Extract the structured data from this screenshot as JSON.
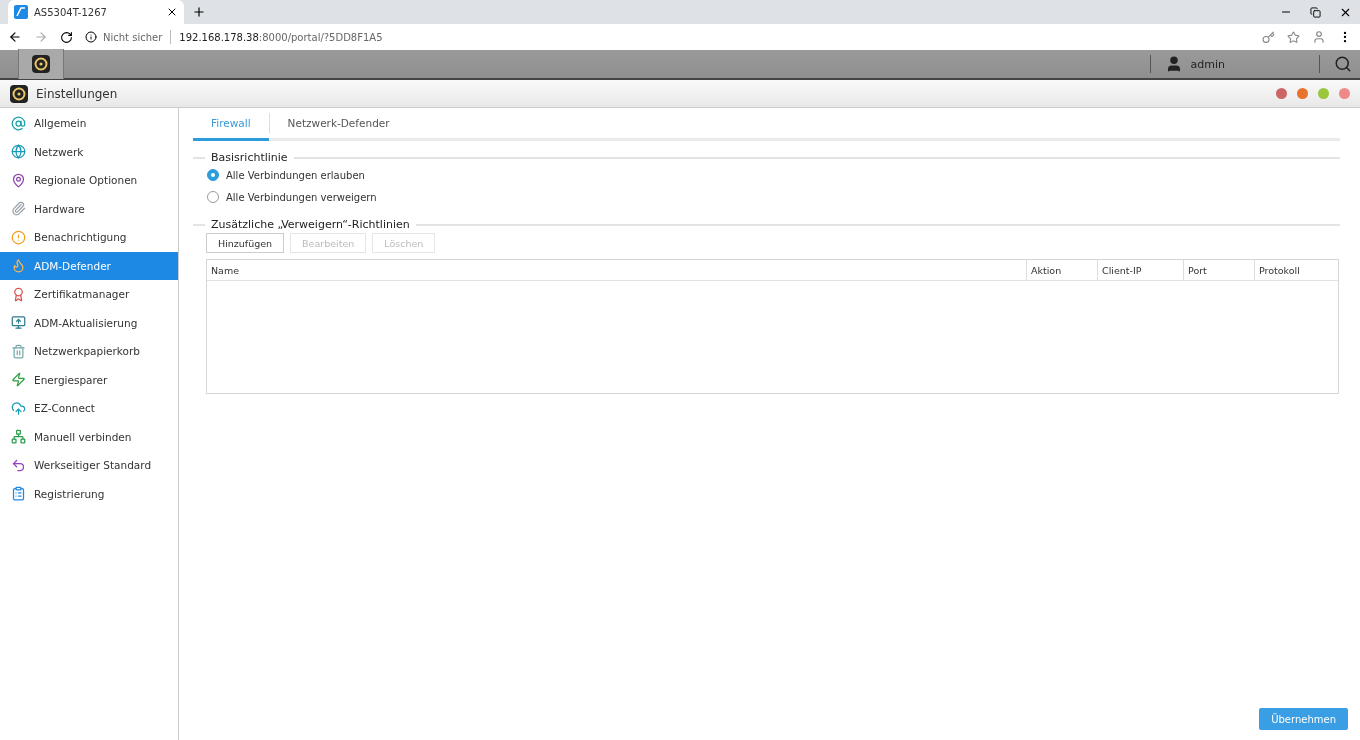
{
  "browser": {
    "tab_title": "AS5304T-1267",
    "security": "Nicht sicher",
    "url_host": "192.168.178.38",
    "url_rest": ":8000/portal/?5DD8F1A5"
  },
  "topbar": {
    "user": "admin"
  },
  "window": {
    "title": "Einstellungen"
  },
  "sidebar": {
    "items": [
      {
        "label": "Allgemein",
        "selected": false
      },
      {
        "label": "Netzwerk",
        "selected": false
      },
      {
        "label": "Regionale Optionen",
        "selected": false
      },
      {
        "label": "Hardware",
        "selected": false
      },
      {
        "label": "Benachrichtigung",
        "selected": false
      },
      {
        "label": "ADM-Defender",
        "selected": true
      },
      {
        "label": "Zertifikatmanager",
        "selected": false
      },
      {
        "label": "ADM-Aktualisierung",
        "selected": false
      },
      {
        "label": "Netzwerkpapierkorb",
        "selected": false
      },
      {
        "label": "Energiesparer",
        "selected": false
      },
      {
        "label": "EZ-Connect",
        "selected": false
      },
      {
        "label": "Manuell verbinden",
        "selected": false
      },
      {
        "label": "Werkseitiger Standard",
        "selected": false
      },
      {
        "label": "Registrierung",
        "selected": false
      }
    ]
  },
  "tabs": [
    {
      "label": "Firewall",
      "selected": true
    },
    {
      "label": "Netzwerk-Defender",
      "selected": false
    }
  ],
  "base_policy": {
    "title": "Basisrichtlinie",
    "options": [
      {
        "label": "Alle Verbindungen erlauben",
        "selected": true
      },
      {
        "label": "Alle Verbindungen verweigern",
        "selected": false
      }
    ]
  },
  "deny_rules": {
    "title": "Zusätzliche „Verweigern“-Richtlinien",
    "buttons": [
      {
        "label": "Hinzufügen",
        "disabled": false
      },
      {
        "label": "Bearbeiten",
        "disabled": true
      },
      {
        "label": "Löschen",
        "disabled": true
      }
    ],
    "table": {
      "columns": [
        "Name",
        "Aktion",
        "Client-IP",
        "Port",
        "Protokoll"
      ]
    }
  },
  "apply_button": "Übernehmen"
}
